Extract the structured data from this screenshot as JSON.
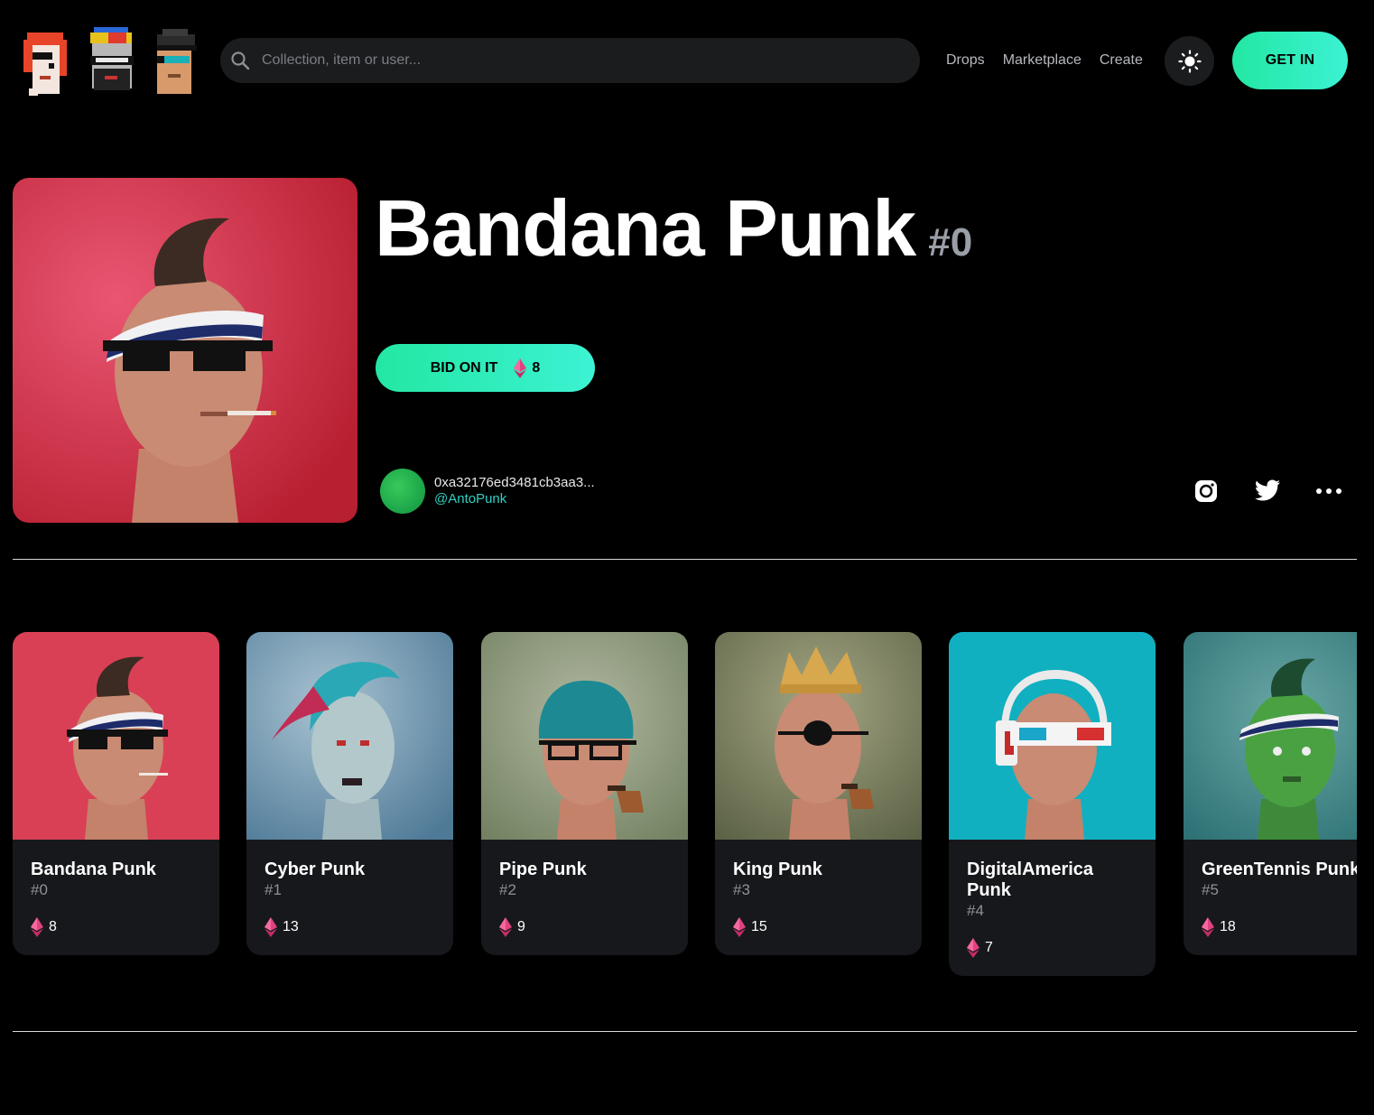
{
  "header": {
    "search_placeholder": "Collection, item or user...",
    "nav": [
      "Drops",
      "Marketplace",
      "Create"
    ],
    "get_in_label": "GET IN"
  },
  "hero": {
    "title": "Bandana Punk",
    "number": "#0",
    "bid_label": "BID ON IT",
    "bid_price": "8",
    "owner_address": "0xa32176ed3481cb3aa3...",
    "owner_handle": "@AntoPunk"
  },
  "cards": [
    {
      "name": "Bandana Punk",
      "number": "#0",
      "price": "8",
      "bg": "#d3364c"
    },
    {
      "name": "Cyber Punk",
      "number": "#1",
      "price": "13",
      "bg": "#6f98b4"
    },
    {
      "name": "Pipe Punk",
      "number": "#2",
      "price": "9",
      "bg": "#8d9a78"
    },
    {
      "name": "King Punk",
      "number": "#3",
      "price": "15",
      "bg": "#7c8266"
    },
    {
      "name": "DigitalAmerica Punk",
      "number": "#4",
      "price": "7",
      "bg": "#16b7c7"
    },
    {
      "name": "GreenTennis Punk",
      "number": "#5",
      "price": "18",
      "bg": "#3e8c8e"
    }
  ],
  "colors": {
    "accent": "#2ff0c0",
    "card_bg": "#17181b",
    "eth": "#e0427f"
  }
}
